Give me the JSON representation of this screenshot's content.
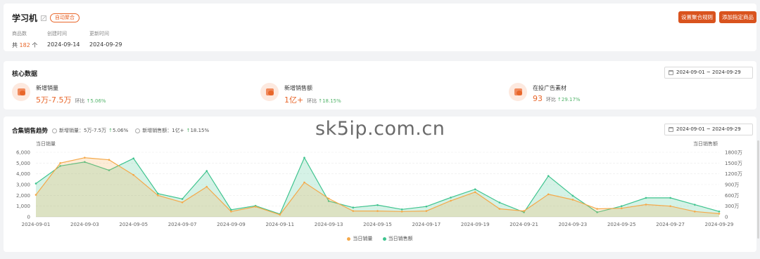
{
  "header": {
    "title": "学习机",
    "tag": "自动聚合",
    "edit_icon": "edit-icon",
    "meta": [
      {
        "key": "商品数",
        "value_prefix": "共 ",
        "value_highlight": "182",
        "value_suffix": " 个"
      },
      {
        "key": "创建时间",
        "value": "2024-09-14"
      },
      {
        "key": "更新时间",
        "value": "2024-09-29"
      }
    ],
    "buttons": {
      "rule": "设置聚合规则",
      "add": "添加指定商品"
    }
  },
  "core": {
    "title": "核心数据",
    "date_range": "2024-09-01 ~ 2024-09-29",
    "metrics": [
      {
        "label": "新增销量",
        "value": "5万-7.5万",
        "ring_label": "环比",
        "change": "5.06%",
        "icon": "sales-volume-icon"
      },
      {
        "label": "新增销售额",
        "value": "1亿+",
        "ring_label": "环比",
        "change": "18.15%",
        "icon": "sales-amount-icon"
      },
      {
        "label": "在投广告素材",
        "value": "93",
        "ring_label": "环比",
        "change": "29.17%",
        "icon": "ad-material-icon"
      }
    ]
  },
  "trend": {
    "title": "合集销售趋势",
    "summary1_label": "新增销量：",
    "summary1_value": "5万-7.5万",
    "summary1_change": "5.06%",
    "summary2_label": "新增销售额：",
    "summary2_value": "1亿+",
    "summary2_change": "18.15%",
    "date_range": "2024-09-01 ~ 2024-09-29"
  },
  "watermark": "sk5ip.com.cn",
  "colors": {
    "accent": "#e8662a",
    "button": "#d9531e",
    "series_sales": "#f5a94a",
    "series_revenue": "#3fc48f"
  },
  "chart_data": {
    "type": "area",
    "x": [
      "2024-09-01",
      "2024-09-02",
      "2024-09-03",
      "2024-09-04",
      "2024-09-05",
      "2024-09-06",
      "2024-09-07",
      "2024-09-08",
      "2024-09-09",
      "2024-09-10",
      "2024-09-11",
      "2024-09-12",
      "2024-09-13",
      "2024-09-14",
      "2024-09-15",
      "2024-09-16",
      "2024-09-17",
      "2024-09-18",
      "2024-09-19",
      "2024-09-20",
      "2024-09-21",
      "2024-09-22",
      "2024-09-23",
      "2024-09-24",
      "2024-09-25",
      "2024-09-26",
      "2024-09-27",
      "2024-09-28",
      "2024-09-29"
    ],
    "x_tick_labels": [
      "2024-09-01",
      "2024-09-03",
      "2024-09-05",
      "2024-09-07",
      "2024-09-09",
      "2024-09-11",
      "2024-09-13",
      "2024-09-15",
      "2024-09-17",
      "2024-09-19",
      "2024-09-21",
      "2024-09-23",
      "2024-09-25",
      "2024-09-27",
      "2024-09-29"
    ],
    "y_left_label": "当日销量",
    "y_right_label": "当日销售额",
    "y_left_ticks": [
      "0",
      "1,000",
      "2,000",
      "3,000",
      "4,000",
      "5,000",
      "6,000"
    ],
    "y_right_ticks": [
      "0",
      "300万",
      "600万",
      "900万",
      "1200万",
      "1500万",
      "1800万"
    ],
    "ylim_left": [
      0,
      6000
    ],
    "ylim_right": [
      0,
      1800
    ],
    "series": [
      {
        "name": "当日销量",
        "axis": "left",
        "color": "#f5a94a",
        "values": [
          2050,
          5000,
          5500,
          5300,
          3900,
          2000,
          1350,
          2800,
          500,
          950,
          200,
          3200,
          1700,
          550,
          550,
          500,
          550,
          1500,
          2300,
          750,
          550,
          2100,
          1600,
          750,
          800,
          1150,
          1000,
          500,
          300
        ]
      },
      {
        "name": "当日销售额",
        "axis": "right",
        "color": "#3fc48f",
        "values": [
          930,
          1420,
          1530,
          1300,
          1630,
          650,
          500,
          1280,
          200,
          310,
          80,
          1650,
          440,
          260,
          330,
          210,
          290,
          540,
          770,
          400,
          130,
          1140,
          590,
          130,
          300,
          530,
          530,
          340,
          150
        ]
      }
    ],
    "legend_position": "bottom-center",
    "grid": true
  }
}
